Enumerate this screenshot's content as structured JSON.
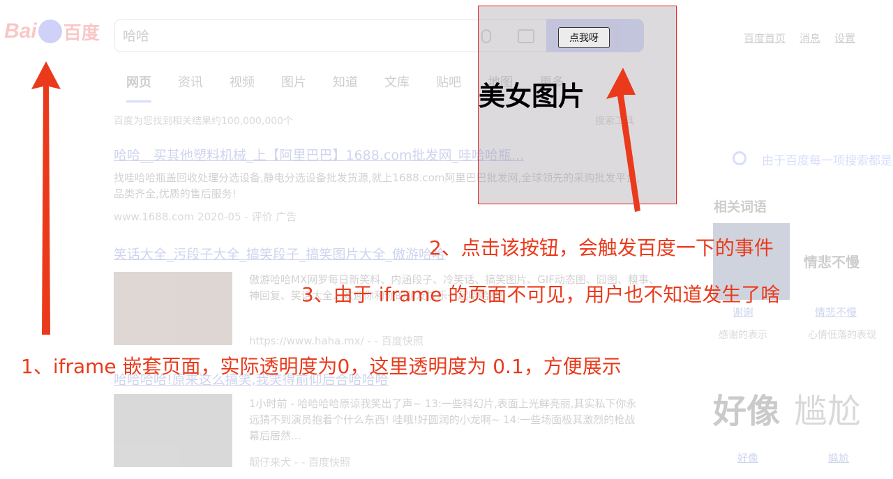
{
  "baidu": {
    "logo_latin": "Bai",
    "logo_cjk": "百度",
    "search_query": "哈哈",
    "top_links": [
      "百度首页",
      "消息",
      "设置"
    ],
    "tabs": [
      "网页",
      "资讯",
      "视频",
      "图片",
      "知道",
      "文库",
      "贴吧",
      "地图",
      "更多"
    ],
    "result_count": "百度为您找到相关结果约100,000,000个",
    "search_tools": "搜索工具",
    "results": [
      {
        "title": "哈哈__买其他塑料机械_上【阿里巴巴】1688.com批发网_哇哈哈瓶...",
        "body": "找哇哈哈瓶盖回收处理分选设备,静电分选设备批发货源,就上1688.com阿里巴巴批发网,全球领先的采购批发平台,品类齐全,优质的售后服务!",
        "url": "www.1688.com   2020-05   - 评价   广告"
      },
      {
        "title": "笑话大全_污段子大全_搞笑段子_搞笑图片大全_傲游哈哈",
        "body": "傲游哈哈MX网罗每日新笑料、内涵段子、冷笑话、搞笑图片、GIF动态图、囧图、糗事、神回复、笑话大全...欢迎你和你的朋友快乐一起哈哈吧!",
        "url": "https://www.haha.mx/  - - 百度快照"
      },
      {
        "title": "哈哈哈哈!原来这么搞笑,我笑得前仰后合哈哈哈",
        "body": "1小时前 - 哈哈哈哈原谅我笑出了声~ 13:一些科幻片,表面上光鲜亮丽,其实私下你永远猜不到演员抱着个什么东西! 哇哦!好圆润的小龙啊~ 14:一些场面极其激烈的枪战幕后居然...",
        "url": "靓仔来犬  - - 百度快照"
      }
    ],
    "sidebar": {
      "feedback": "由于百度每一项搜索都是...",
      "related_title": "相关词语",
      "related_img_word": "情悲不慢",
      "captions": [
        "谢谢",
        "情悲不慢"
      ],
      "subs": [
        "感谢的表示",
        "心情低落的表现"
      ],
      "big_word_1": "好像",
      "big_word_2": "尴尬",
      "bottom_links": [
        "好像",
        "尴尬"
      ]
    }
  },
  "iframe": {
    "button_label": "点我呀",
    "title": "美女图片"
  },
  "annotations": {
    "note_1": "1、iframe 嵌套页面，实际透明度为0，这里透明度为 0.1，方便展示",
    "note_2": "2、点击该按钮，会触发百度一下的事件",
    "note_3": "3、由于 iframe 的页面不可见，用户也不知道发生了啥"
  },
  "colors": {
    "annotation": "#ea3a1b",
    "frame_border": "#e0201e",
    "baidu_blue": "#4e6ef2"
  }
}
